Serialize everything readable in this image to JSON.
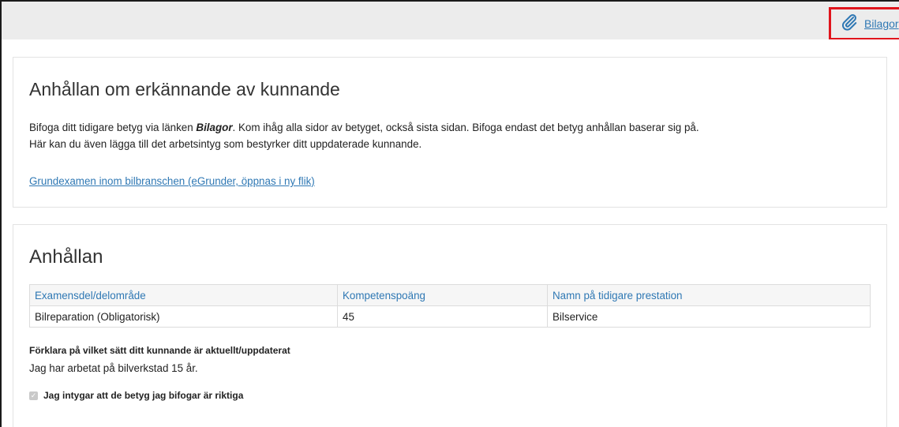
{
  "toolbar": {
    "attachments_label": "Bilagor",
    "attachments_icon": "paperclip-icon"
  },
  "info_panel": {
    "title": "Anhållan om erkännande av kunnande",
    "intro_prefix": "Bifoga ditt tidigare betyg via länken ",
    "intro_link_word": "Bilagor",
    "intro_suffix": ". Kom ihåg alla sidor av betyget, också sista sidan. Bifoga endast det betyg anhållan baserar sig på.",
    "intro_line2": "Här kan du även lägga till det arbetsintyg som bestyrker ditt uppdaterade kunnande.",
    "external_link": "Grundexamen inom bilbranschen (eGrunder, öppnas i ny flik)"
  },
  "request_panel": {
    "title": "Anhållan",
    "table": {
      "headers": [
        "Examensdel/delområde",
        "Kompetenspoäng",
        "Namn på tidigare prestation"
      ],
      "rows": [
        [
          "Bilreparation (Obligatorisk)",
          "45",
          "Bilservice"
        ]
      ]
    },
    "explain_label": "Förklara på vilket sätt ditt kunnande är aktuellt/uppdaterat",
    "explain_value": "Jag har arbetat på bilverkstad 15 år.",
    "confirm_label": "Jag intygar att de betyg jag bifogar är riktiga",
    "confirm_checked": true
  },
  "colors": {
    "link": "#2f78b4",
    "highlight_border": "#e0141c",
    "topbar_bg": "#ececec"
  }
}
